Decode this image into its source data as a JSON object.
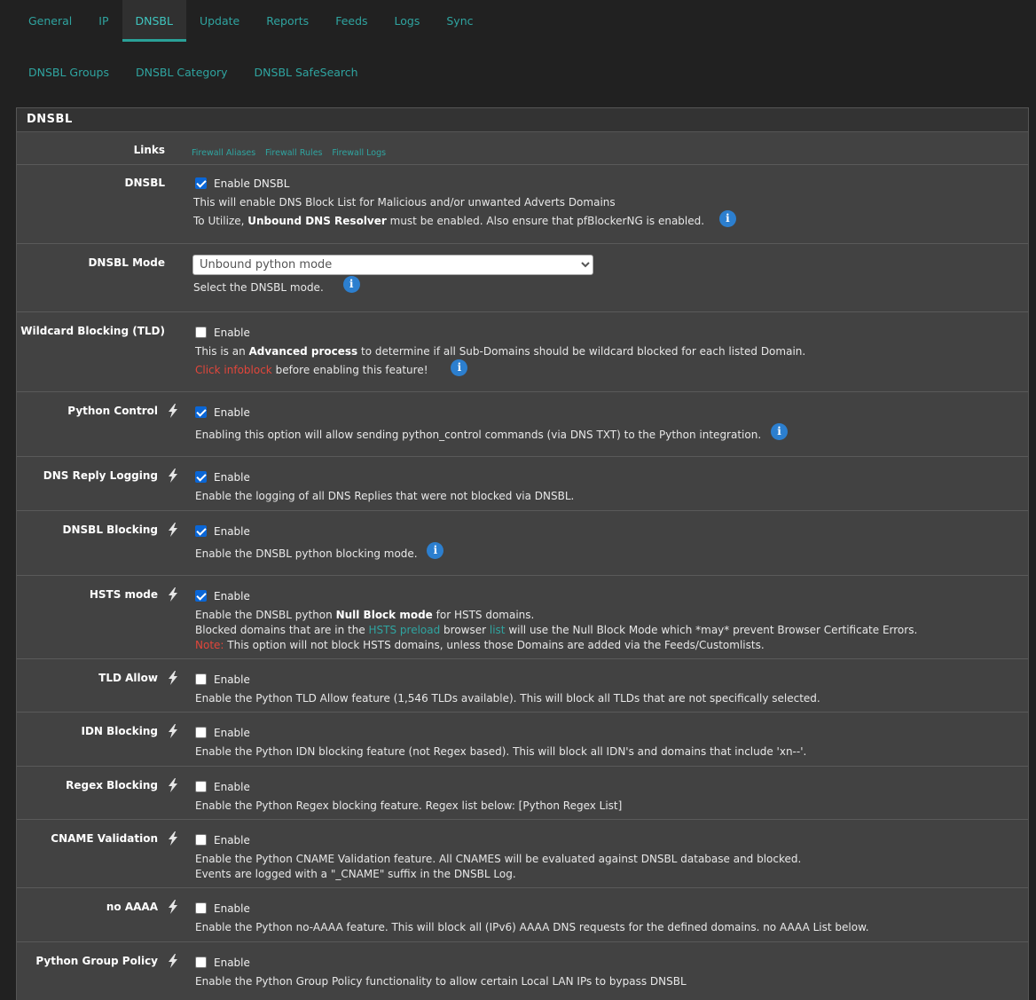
{
  "tabs": [
    "General",
    "IP",
    "DNSBL",
    "Update",
    "Reports",
    "Feeds",
    "Logs",
    "Sync"
  ],
  "active_tab": "DNSBL",
  "subtabs": [
    "DNSBL Groups",
    "DNSBL Category",
    "DNSBL SafeSearch"
  ],
  "panel": {
    "title": "DNSBL",
    "links": {
      "label": "Links",
      "items": [
        "Firewall Aliases",
        "Firewall Rules",
        "Firewall Logs"
      ]
    },
    "dnsbl": {
      "label": "DNSBL",
      "checkbox_text": "Enable DNSBL",
      "checked": true,
      "line1": "This will enable DNS Block List for Malicious and/or unwanted Adverts Domains",
      "line2_pre": "To Utilize, ",
      "line2_bold": "Unbound DNS Resolver",
      "line2_post": " must be enabled. Also ensure that pfBlockerNG is enabled."
    },
    "mode": {
      "label": "DNSBL Mode",
      "selected": "Unbound python mode",
      "help": "Select the DNSBL mode."
    },
    "wildcard": {
      "label": "Wildcard Blocking (TLD)",
      "checkbox_text": "Enable",
      "checked": false,
      "line1_pre": "This is an ",
      "line1_bold": "Advanced process",
      "line1_post": " to determine if all Sub-Domains should be wildcard blocked for each listed Domain.",
      "line2_red": "Click infoblock",
      "line2_post": " before enabling this feature!"
    },
    "python_control": {
      "label": "Python Control",
      "checkbox_text": "Enable",
      "checked": true,
      "help": "Enabling this option will allow sending python_control commands (via DNS TXT) to the Python integration."
    },
    "reply_logging": {
      "label": "DNS Reply Logging",
      "checkbox_text": "Enable",
      "checked": true,
      "help": "Enable the logging of all DNS Replies that were not blocked via DNSBL."
    },
    "dnsbl_blocking": {
      "label": "DNSBL Blocking",
      "checkbox_text": "Enable",
      "checked": true,
      "help": "Enable the DNSBL python blocking mode."
    },
    "hsts": {
      "label": "HSTS mode",
      "checkbox_text": "Enable",
      "checked": true,
      "line1_pre": "Enable the DNSBL python ",
      "line1_bold": "Null Block mode",
      "line1_post": " for HSTS domains.",
      "line2_pre": "Blocked domains that are in the ",
      "line2_link1": "HSTS preload",
      "line2_mid": " browser ",
      "line2_link2": "list",
      "line2_post": " will use the Null Block Mode which *may* prevent Browser Certificate Errors.",
      "line3_red": "Note:",
      "line3_post": " This option will not block HSTS domains, unless those Domains are added via the Feeds/Customlists."
    },
    "tld_allow": {
      "label": "TLD Allow",
      "checkbox_text": "Enable",
      "checked": false,
      "help": "Enable the Python TLD Allow feature (1,546 TLDs available). This will block all TLDs that are not specifically selected."
    },
    "idn": {
      "label": "IDN Blocking",
      "checkbox_text": "Enable",
      "checked": false,
      "help": "Enable the Python IDN blocking feature (not Regex based). This will block all IDN's and domains that include 'xn--'."
    },
    "regex": {
      "label": "Regex Blocking",
      "checkbox_text": "Enable",
      "checked": false,
      "help": "Enable the Python Regex blocking feature. Regex list below: [Python Regex List]"
    },
    "cname": {
      "label": "CNAME Validation",
      "checkbox_text": "Enable",
      "checked": false,
      "line1": "Enable the Python CNAME Validation feature. All CNAMES will be evaluated against DNSBL database and blocked.",
      "line2": "Events are logged with a \"_CNAME\" suffix in the DNSBL Log."
    },
    "no_aaaa": {
      "label": "no AAAA",
      "checkbox_text": "Enable",
      "checked": false,
      "help": "Enable the Python no-AAAA feature. This will block all (IPv6) AAAA DNS requests for the defined domains. no AAAA List below."
    },
    "group_policy": {
      "label": "Python Group Policy",
      "checkbox_text": "Enable",
      "checked": false,
      "help": "Enable the Python Group Policy functionality to allow certain Local LAN IPs to bypass DNSBL"
    },
    "info_icon": "info-circle-icon",
    "bolt_icon": "lightning-bolt-icon",
    "colors": {
      "accent": "#2fa4a0",
      "info": "#2c7fcf",
      "warning": "#e2463b",
      "checkbox": "#0a66d6"
    }
  }
}
